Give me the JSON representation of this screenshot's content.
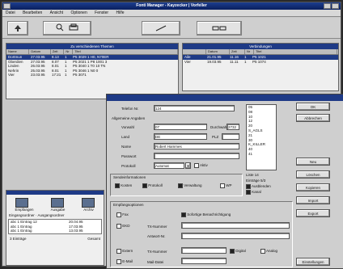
{
  "app": {
    "title": "Fonti Manager - Kayzecker | Vorfeller"
  },
  "menu": [
    "Datei",
    "Bearbeiten",
    "Ansicht",
    "Optionen",
    "Fenster",
    "Hilfe"
  ],
  "toolbar": {
    "buttons": [
      "arrow-up-icon",
      "search-icon",
      "printer-icon",
      "divider",
      "tools-icon",
      "link-icon"
    ]
  },
  "left_panel": {
    "title": "Zu verschiedenen Themen",
    "columns": [
      "Name",
      "Datum",
      "Zeit",
      "Nr",
      "Titel"
    ],
    "rows": [
      [
        "Dortmun",
        "27.03.95",
        "8.13",
        "1",
        "P5 3029 1  H0, N70ER"
      ],
      [
        "Oberdien",
        "27.03.95",
        "8.07",
        "1",
        "P5 2021 1  P8 1001 3"
      ],
      [
        "Linden",
        "26.03.95",
        "8.01",
        "1",
        "P5 3040 1  T0 10 TN"
      ],
      [
        "Nehrin",
        "25.03.95",
        "8.01",
        "1",
        "P5 3046 1  N0 0"
      ],
      [
        "Vier",
        "23.03.95",
        "17:21",
        "1",
        "P5 3071"
      ]
    ]
  },
  "right_panel": {
    "title": "Verbindungen",
    "columns": [
      "",
      "Datum",
      "Zeit",
      "Nr",
      "Titel"
    ],
    "rows": [
      [
        "Aile",
        "21.01.95",
        "11.16",
        "1",
        "P5 1021"
      ],
      [
        "Vier",
        "19.03.95",
        "11.11",
        "1",
        "P5 1074"
      ]
    ]
  },
  "bottom_left": {
    "icon_labels": [
      "Empfangen",
      "Ausgabe",
      "Archiv"
    ],
    "caption": "Eingangsordner · Ausgangsordner",
    "rows": [
      [
        "abc 1 Eintrag 12",
        "20.04.95"
      ],
      [
        "abc 1 Eintrag",
        "17.03.95"
      ],
      [
        "abc 1 Eintrag",
        "13.03.95"
      ]
    ],
    "status": [
      "3 Einträge",
      "Gesamt"
    ]
  },
  "dialog": {
    "fields": {
      "telefon_label": "Telefon Nr.",
      "telefon_value": "124",
      "section_allgemein": "Allgemeine Angaben",
      "vorwahl_label": "Vorwahl",
      "vorwahl_value": "07",
      "durchwahl_label": "Durchwahl",
      "durchwahl_value": "2732",
      "land_label": "Land",
      "land_value": "DE",
      "plz_label": "PLZ",
      "name_label": "Name",
      "name_value": "Robert Hammes",
      "passwort_label": "Passwort",
      "protokoll_label": "Protokoll",
      "protokoll_value": "Automat",
      "aktiv_label": "Aktiv",
      "section_sende": "Sendeinformationen",
      "opt_kosten": "Kosten",
      "opt_protokoll": "Protokoll",
      "opt_verwaltung": "Verwaltung",
      "opt_wp": "WP",
      "section_empfang": "Empfangsoptionen",
      "opt_fax": "Fax",
      "opt_sofort": "Sofortige Benachrichtigung",
      "opt_ekd": "EKD",
      "opt_tx": "TX-Nummer",
      "antwort_label": "Antwort-Nr.",
      "opt_extern": "Extern",
      "tx_label": "TX-Nummer",
      "opt_digital": "Digital",
      "opt_analog": "Analog",
      "opt_email": "E-Mail",
      "mail_label": "Mail-Datei"
    },
    "list_items": [
      "05",
      "08",
      "10",
      "12",
      "20",
      "S_AGLS",
      "21",
      "30",
      "K_KILLER",
      "40",
      "41"
    ],
    "list_caption": "Liste 14",
    "list_caption2": "Einträge 5/3",
    "list_opt1": "Ausblenden",
    "list_opt2": "Kanal",
    "buttons": [
      "OK",
      "Abbrechen",
      "Neu",
      "Löschen",
      "Kopieren",
      "Import",
      "Export",
      "Einstellungen"
    ]
  }
}
